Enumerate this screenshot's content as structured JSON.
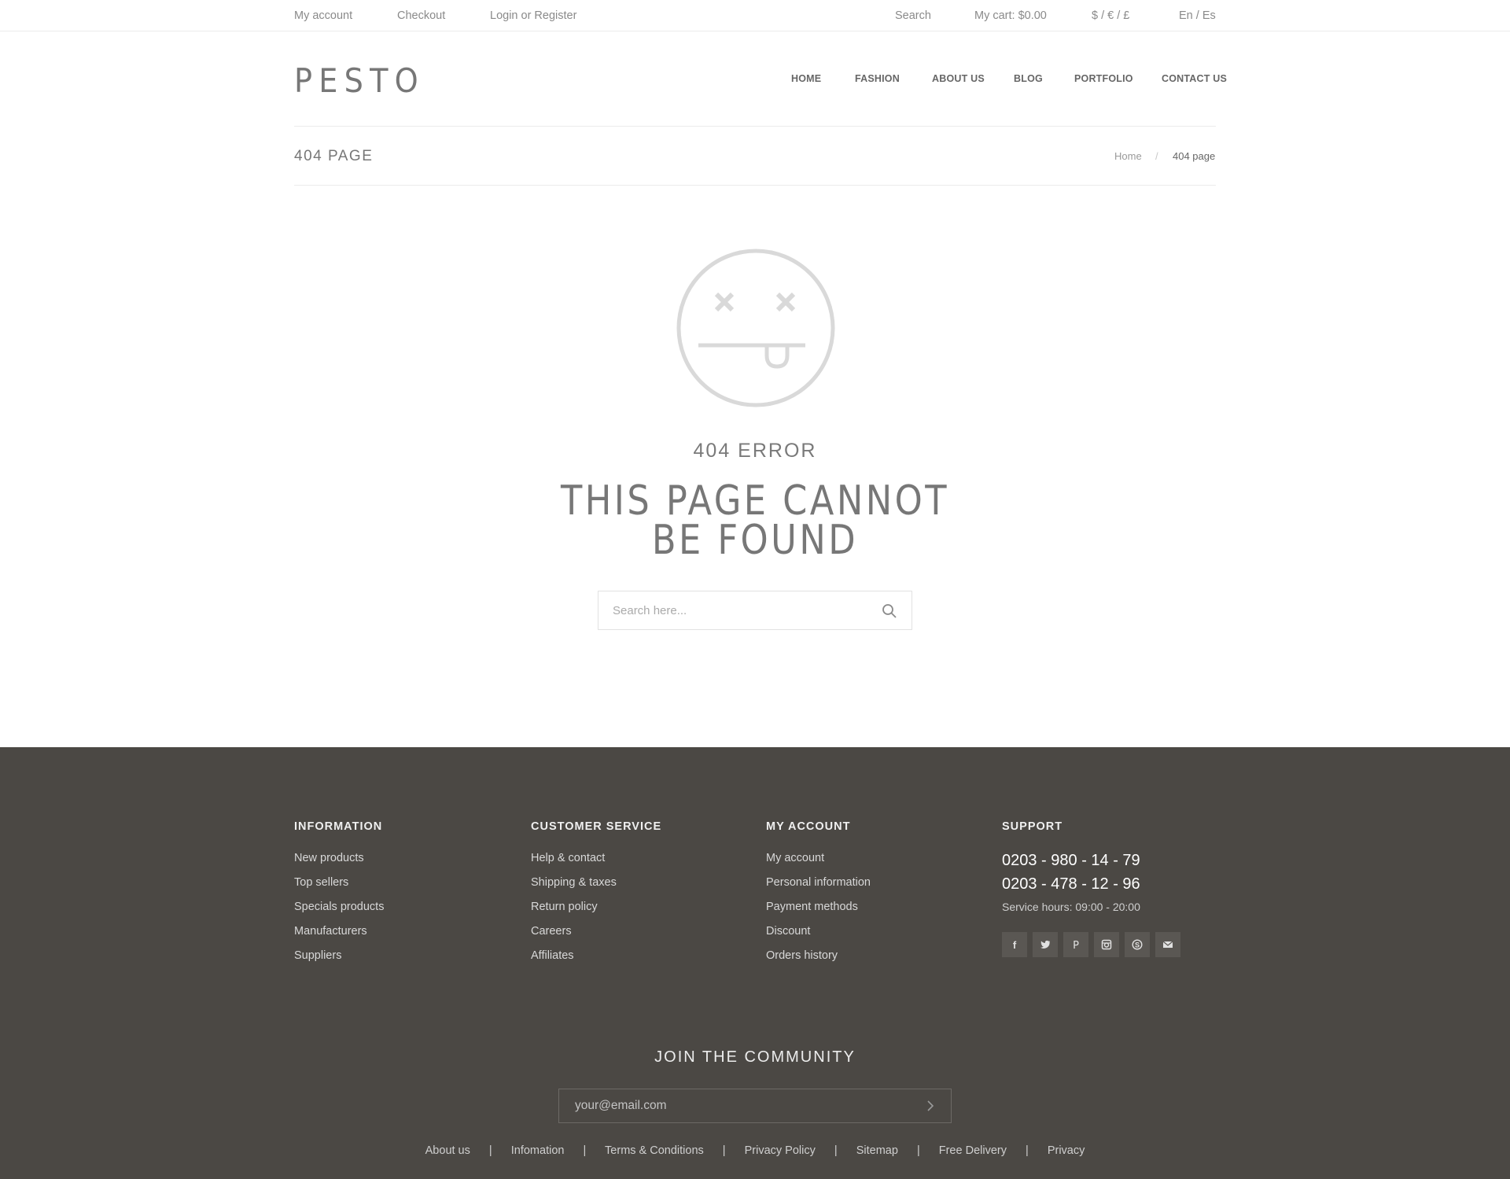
{
  "topbar": {
    "my_account": "My account",
    "checkout": "Checkout",
    "login": "Login or Register",
    "search": "Search",
    "cart": "My cart: $0.00",
    "currency": "$ / € / £",
    "language": "En / Es"
  },
  "logo": {
    "text": "PESTO"
  },
  "nav": {
    "items": [
      {
        "label": "HOME"
      },
      {
        "label": "FASHION"
      },
      {
        "label": "ABOUT US"
      },
      {
        "label": "BLOG"
      },
      {
        "label": "PORTFOLIO"
      },
      {
        "label": "CONTACT US"
      }
    ]
  },
  "page": {
    "title": "404 PAGE",
    "breadcrumb": {
      "home": "Home",
      "separator": "/",
      "current": "404 page"
    }
  },
  "error": {
    "code": "404 ERROR",
    "title_line1": "THIS PAGE CANNOT",
    "title_line2": "BE FOUND",
    "face_icon": "dead-face-icon",
    "search_placeholder": "Search here...",
    "search_icon": "search-icon"
  },
  "footer": {
    "background": "#4b4844",
    "information": {
      "heading": "INFORMATION",
      "links": [
        "New products",
        "Top sellers",
        "Specials products",
        "Manufacturers",
        "Suppliers"
      ]
    },
    "customer_service": {
      "heading": "CUSTOMER SERVICE",
      "links": [
        "Help & contact",
        "Shipping & taxes",
        "Return policy",
        "Careers",
        "Affiliates"
      ]
    },
    "my_account": {
      "heading": "MY ACCOUNT",
      "links": [
        "My account",
        "Personal information",
        "Payment methods",
        "Discount",
        "Orders history"
      ]
    },
    "support": {
      "heading": "SUPPORT",
      "phones": [
        "0203 - 980 - 14 - 79",
        "0203 - 478 - 12 - 96"
      ],
      "hours": "Service hours: 09:00 - 20:00",
      "socials": [
        "facebook-icon",
        "twitter-icon",
        "pinterest-icon",
        "instagram-icon",
        "skype-icon",
        "mail-icon"
      ]
    },
    "newsletter": {
      "heading": "JOIN THE COMMUNITY",
      "placeholder": "your@email.com",
      "submit_icon": "chevron-right-icon"
    },
    "bottom_links": {
      "separator": "|",
      "items": [
        "About us",
        "Infomation",
        "Terms & Conditions",
        "Privacy Policy",
        "Sitemap",
        "Free Delivery",
        "Privacy"
      ]
    }
  }
}
